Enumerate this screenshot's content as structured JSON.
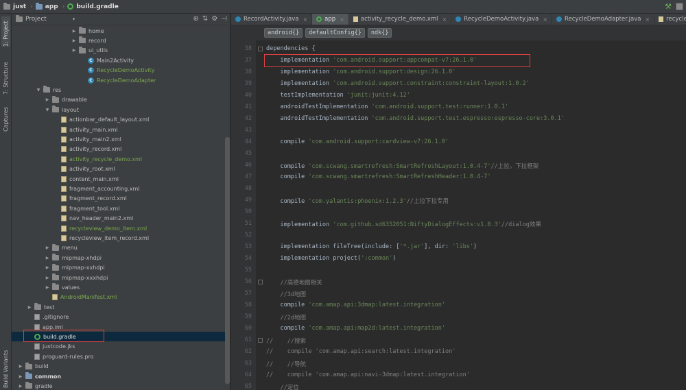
{
  "navbar": {
    "crumbs": [
      "just",
      "app",
      "build.gradle"
    ],
    "separators": [
      "›",
      "›"
    ]
  },
  "left_strip": {
    "tabs": [
      "1: Project",
      "7: Structure",
      "Captures",
      "Build Variants"
    ]
  },
  "project_panel": {
    "title": "Project",
    "dropdown": "▾",
    "tools": [
      "⊕",
      "⇅",
      "⚙",
      "⊣"
    ]
  },
  "tree": [
    {
      "label": "home",
      "type": "folder",
      "depth": 7,
      "arrow": "▶",
      "style": ""
    },
    {
      "label": "record",
      "type": "folder",
      "depth": 7,
      "arrow": "▶",
      "style": ""
    },
    {
      "label": "ui_utils",
      "type": "folder",
      "depth": 7,
      "arrow": "▶",
      "style": ""
    },
    {
      "label": "Main2Activity",
      "type": "class",
      "depth": 8,
      "arrow": "",
      "style": ""
    },
    {
      "label": "RecycleDemoActivity",
      "type": "class",
      "depth": 8,
      "arrow": "",
      "style": "green"
    },
    {
      "label": "RecycleDemoAdapter",
      "type": "class",
      "depth": 8,
      "arrow": "",
      "style": "green"
    },
    {
      "label": "res",
      "type": "folder",
      "depth": 3,
      "arrow": "▼",
      "style": ""
    },
    {
      "label": "drawable",
      "type": "folder",
      "depth": 4,
      "arrow": "▶",
      "style": ""
    },
    {
      "label": "layout",
      "type": "folder",
      "depth": 4,
      "arrow": "▼",
      "style": ""
    },
    {
      "label": "actionbar_default_layout.xml",
      "type": "xml",
      "depth": 5,
      "arrow": "",
      "style": ""
    },
    {
      "label": "activity_main.xml",
      "type": "xml",
      "depth": 5,
      "arrow": "",
      "style": ""
    },
    {
      "label": "activity_main2.xml",
      "type": "xml",
      "depth": 5,
      "arrow": "",
      "style": ""
    },
    {
      "label": "activity_record.xml",
      "type": "xml",
      "depth": 5,
      "arrow": "",
      "style": ""
    },
    {
      "label": "activity_recycle_demo.xml",
      "type": "xml",
      "depth": 5,
      "arrow": "",
      "style": "green"
    },
    {
      "label": "activity_root.xml",
      "type": "xml",
      "depth": 5,
      "arrow": "",
      "style": ""
    },
    {
      "label": "content_main.xml",
      "type": "xml",
      "depth": 5,
      "arrow": "",
      "style": ""
    },
    {
      "label": "fragment_accounting.xml",
      "type": "xml",
      "depth": 5,
      "arrow": "",
      "style": ""
    },
    {
      "label": "fragment_record.xml",
      "type": "xml",
      "depth": 5,
      "arrow": "",
      "style": ""
    },
    {
      "label": "fragment_tool.xml",
      "type": "xml",
      "depth": 5,
      "arrow": "",
      "style": ""
    },
    {
      "label": "nav_header_main2.xml",
      "type": "xml",
      "depth": 5,
      "arrow": "",
      "style": ""
    },
    {
      "label": "recycleview_demo_item.xml",
      "type": "xml",
      "depth": 5,
      "arrow": "",
      "style": "green"
    },
    {
      "label": "recycleview_item_record.xml",
      "type": "xml",
      "depth": 5,
      "arrow": "",
      "style": ""
    },
    {
      "label": "menu",
      "type": "folder",
      "depth": 4,
      "arrow": "▶",
      "style": ""
    },
    {
      "label": "mipmap-xhdpi",
      "type": "folder",
      "depth": 4,
      "arrow": "▶",
      "style": ""
    },
    {
      "label": "mipmap-xxhdpi",
      "type": "folder",
      "depth": 4,
      "arrow": "▶",
      "style": ""
    },
    {
      "label": "mipmap-xxxhdpi",
      "type": "folder",
      "depth": 4,
      "arrow": "▶",
      "style": ""
    },
    {
      "label": "values",
      "type": "folder",
      "depth": 4,
      "arrow": "▶",
      "style": ""
    },
    {
      "label": "AndroidManifest.xml",
      "type": "xml",
      "depth": 4,
      "arrow": "",
      "style": "green"
    },
    {
      "label": "test",
      "type": "folder",
      "depth": 2,
      "arrow": "▶",
      "style": ""
    },
    {
      "label": ".gitignore",
      "type": "file",
      "depth": 2,
      "arrow": "",
      "style": ""
    },
    {
      "label": "app.iml",
      "type": "file",
      "depth": 2,
      "arrow": "",
      "style": ""
    },
    {
      "label": "build.gradle",
      "type": "gradle",
      "depth": 2,
      "arrow": "",
      "style": "selected"
    },
    {
      "label": "justcode.jks",
      "type": "file",
      "depth": 2,
      "arrow": "",
      "style": ""
    },
    {
      "label": "proguard-rules.pro",
      "type": "file",
      "depth": 2,
      "arrow": "",
      "style": ""
    },
    {
      "label": "build",
      "type": "folder",
      "depth": 1,
      "arrow": "▶",
      "style": ""
    },
    {
      "label": "common",
      "type": "folder-blue",
      "depth": 1,
      "arrow": "▶",
      "style": "bold"
    },
    {
      "label": "gradle",
      "type": "folder",
      "depth": 1,
      "arrow": "▶",
      "style": ""
    }
  ],
  "tabs": [
    {
      "label": "RecordActivity.java",
      "icon": "class",
      "active": false
    },
    {
      "label": "app",
      "icon": "gradle",
      "active": true
    },
    {
      "label": "activity_recycle_demo.xml",
      "icon": "xml",
      "active": false
    },
    {
      "label": "RecycleDemoActivity.java",
      "icon": "class",
      "active": false
    },
    {
      "label": "RecycleDemoAdapter.java",
      "icon": "class",
      "active": false
    },
    {
      "label": "recycleview_dem",
      "icon": "xml",
      "active": false
    }
  ],
  "tab_close": "×",
  "editor_crumbs": [
    "android{}",
    "defaultConfig{}",
    "ndk{}"
  ],
  "code_lines": [
    {
      "n": "38",
      "parts": [
        [
          "plain",
          "dependencies {"
        ]
      ]
    },
    {
      "n": "37",
      "parts": [
        [
          "plain",
          "    implementation "
        ],
        [
          "str",
          "'com.android.support:appcompat-v7:26.1.0'"
        ]
      ]
    },
    {
      "n": "38",
      "parts": [
        [
          "plain",
          "    implementation "
        ],
        [
          "str",
          "'com.android.support:design:26.1.0'"
        ]
      ]
    },
    {
      "n": "39",
      "parts": [
        [
          "plain",
          "    implementation "
        ],
        [
          "str",
          "'com.android.support.constraint:constraint-layout:1.0.2'"
        ]
      ]
    },
    {
      "n": "40",
      "parts": [
        [
          "plain",
          "    testImplementation "
        ],
        [
          "str",
          "'junit:junit:4.12'"
        ]
      ]
    },
    {
      "n": "41",
      "parts": [
        [
          "plain",
          "    androidTestImplementation "
        ],
        [
          "str",
          "'com.android.support.test:runner:1.0.1'"
        ]
      ]
    },
    {
      "n": "42",
      "parts": [
        [
          "plain",
          "    androidTestImplementation "
        ],
        [
          "str",
          "'com.android.support.test.espresso:espresso-core:3.0.1'"
        ]
      ]
    },
    {
      "n": "43",
      "parts": [
        [
          "plain",
          ""
        ]
      ]
    },
    {
      "n": "44",
      "parts": [
        [
          "plain",
          "    compile "
        ],
        [
          "str",
          "'com.android.support:cardview-v7:26.1.0'"
        ]
      ]
    },
    {
      "n": "45",
      "parts": [
        [
          "plain",
          ""
        ]
      ]
    },
    {
      "n": "46",
      "parts": [
        [
          "plain",
          "    compile "
        ],
        [
          "str",
          "'com.scwang.smartrefresh:SmartRefreshLayout:1.0.4-7'"
        ],
        [
          "cm",
          "//上拉，下拉框架"
        ]
      ]
    },
    {
      "n": "47",
      "parts": [
        [
          "plain",
          "    compile "
        ],
        [
          "str",
          "'com.scwang.smartrefresh:SmartRefreshHeader:1.0.4-7'"
        ]
      ]
    },
    {
      "n": "48",
      "parts": [
        [
          "plain",
          ""
        ]
      ]
    },
    {
      "n": "49",
      "parts": [
        [
          "plain",
          "    compile "
        ],
        [
          "str",
          "'com.yalantis:phoenix:1.2.3'"
        ],
        [
          "cm",
          "//上拉下拉专用"
        ]
      ]
    },
    {
      "n": "50",
      "parts": [
        [
          "plain",
          ""
        ]
      ]
    },
    {
      "n": "51",
      "parts": [
        [
          "plain",
          "    implementation "
        ],
        [
          "str",
          "'com.github.sd6352051:NiftyDialogEffects:v1.0.3'"
        ],
        [
          "cm",
          "//dialog效果"
        ]
      ]
    },
    {
      "n": "52",
      "parts": [
        [
          "plain",
          ""
        ]
      ]
    },
    {
      "n": "53",
      "parts": [
        [
          "plain",
          "    implementation fileTree(include: ["
        ],
        [
          "str",
          "'*.jar'"
        ],
        [
          "plain",
          "], dir: "
        ],
        [
          "str",
          "'libs'"
        ],
        [
          "plain",
          ")"
        ]
      ]
    },
    {
      "n": "54",
      "parts": [
        [
          "plain",
          "    implementation project("
        ],
        [
          "str",
          "':common'"
        ],
        [
          "plain",
          ")"
        ]
      ]
    },
    {
      "n": "55",
      "parts": [
        [
          "plain",
          ""
        ]
      ]
    },
    {
      "n": "56",
      "parts": [
        [
          "cm",
          "    //高德地图相关"
        ]
      ]
    },
    {
      "n": "57",
      "parts": [
        [
          "cm",
          "    //3d地图"
        ]
      ]
    },
    {
      "n": "58",
      "parts": [
        [
          "plain",
          "    compile "
        ],
        [
          "str",
          "'com.amap.api:3dmap:latest.integration'"
        ]
      ]
    },
    {
      "n": "59",
      "parts": [
        [
          "cm",
          "    //2d地图"
        ]
      ]
    },
    {
      "n": "60",
      "parts": [
        [
          "plain",
          "    compile "
        ],
        [
          "str",
          "'com.amap.api:map2d:latest.integration'"
        ]
      ]
    },
    {
      "n": "61",
      "parts": [
        [
          "cm",
          "//    //搜索"
        ]
      ]
    },
    {
      "n": "62",
      "parts": [
        [
          "cm",
          "//    compile 'com.amap.api:search:latest.integration'"
        ]
      ]
    },
    {
      "n": "63",
      "parts": [
        [
          "cm",
          "//    //导航"
        ]
      ]
    },
    {
      "n": "64",
      "parts": [
        [
          "cm",
          "//    compile 'com.amap.api:navi-3dmap:latest.integration'"
        ]
      ]
    },
    {
      "n": "65",
      "parts": [
        [
          "cm",
          "    //定位"
        ]
      ]
    }
  ],
  "colors": {
    "string": "#6a8759",
    "comment": "#808080",
    "highlight_box": "#e04040",
    "selection": "#0d293e"
  }
}
